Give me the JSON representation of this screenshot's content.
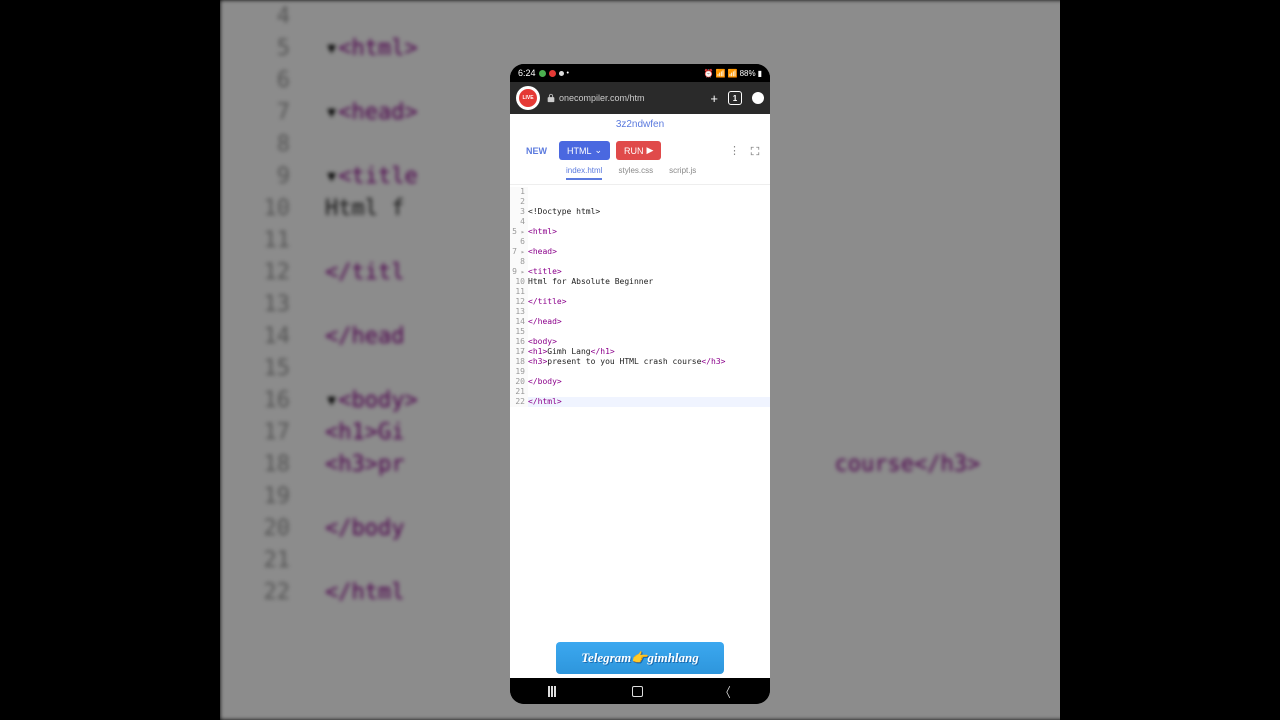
{
  "status": {
    "time": "6:24",
    "battery": "88%"
  },
  "browser": {
    "url": "onecompiler.com/htm",
    "live_label": "LIVE"
  },
  "file_id": "3z2ndwfen",
  "toolbar": {
    "new_label": "NEW",
    "html_label": "HTML",
    "run_label": "RUN"
  },
  "tabs": {
    "index": "index.html",
    "styles": "styles.css",
    "script": "script.js"
  },
  "code": {
    "line3": "<!Doctype html>",
    "line5_o": "<html>",
    "line7_o": "<head>",
    "line9_o": "<title>",
    "line10": "Html for Absolute Beginner",
    "line12_c": "</title>",
    "line14_c": "</head>",
    "line16_o": "<body>",
    "line17_h1o": "<h1>",
    "line17_txt": "Gimh Lang",
    "line17_h1c": "</h1>",
    "line18_h3o": "<h3>",
    "line18_txt": "present to you HTML crash course",
    "line18_h3c": "</h3>",
    "line20_c": "</body>",
    "line22_c": "</html>"
  },
  "telegram": "Telegram👉gimhlang",
  "bg": {
    "l4": "4",
    "l5": "5",
    "l5t": "<html>",
    "l6": "6",
    "l7": "7",
    "l7t": "<head>",
    "l8": "8",
    "l9": "9",
    "l9t": "<title",
    "l10": "10",
    "l10t": "Html f",
    "l11": "11",
    "l12": "12",
    "l12t": "</titl",
    "l13": "13",
    "l14": "14",
    "l14t": "</head",
    "l15": "15",
    "l16": "16",
    "l16t": "<body>",
    "l17": "17",
    "l17t": "<h1>Gi",
    "l18": "18",
    "l18t": "<h3>pr",
    "l18r": "course</h3>",
    "l19": "19",
    "l20": "20",
    "l20t": "</body",
    "l21": "21",
    "l22": "22",
    "l22t": "</html"
  }
}
